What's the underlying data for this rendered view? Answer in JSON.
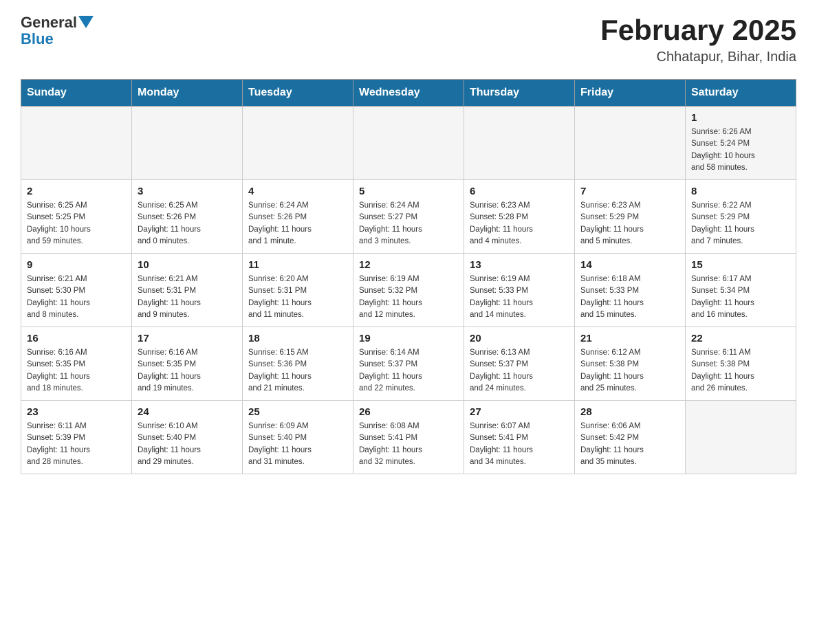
{
  "header": {
    "logo_general": "General",
    "logo_blue": "Blue",
    "month_title": "February 2025",
    "location": "Chhatapur, Bihar, India"
  },
  "weekdays": [
    "Sunday",
    "Monday",
    "Tuesday",
    "Wednesday",
    "Thursday",
    "Friday",
    "Saturday"
  ],
  "weeks": [
    [
      {
        "day": "",
        "info": ""
      },
      {
        "day": "",
        "info": ""
      },
      {
        "day": "",
        "info": ""
      },
      {
        "day": "",
        "info": ""
      },
      {
        "day": "",
        "info": ""
      },
      {
        "day": "",
        "info": ""
      },
      {
        "day": "1",
        "info": "Sunrise: 6:26 AM\nSunset: 5:24 PM\nDaylight: 10 hours\nand 58 minutes."
      }
    ],
    [
      {
        "day": "2",
        "info": "Sunrise: 6:25 AM\nSunset: 5:25 PM\nDaylight: 10 hours\nand 59 minutes."
      },
      {
        "day": "3",
        "info": "Sunrise: 6:25 AM\nSunset: 5:26 PM\nDaylight: 11 hours\nand 0 minutes."
      },
      {
        "day": "4",
        "info": "Sunrise: 6:24 AM\nSunset: 5:26 PM\nDaylight: 11 hours\nand 1 minute."
      },
      {
        "day": "5",
        "info": "Sunrise: 6:24 AM\nSunset: 5:27 PM\nDaylight: 11 hours\nand 3 minutes."
      },
      {
        "day": "6",
        "info": "Sunrise: 6:23 AM\nSunset: 5:28 PM\nDaylight: 11 hours\nand 4 minutes."
      },
      {
        "day": "7",
        "info": "Sunrise: 6:23 AM\nSunset: 5:29 PM\nDaylight: 11 hours\nand 5 minutes."
      },
      {
        "day": "8",
        "info": "Sunrise: 6:22 AM\nSunset: 5:29 PM\nDaylight: 11 hours\nand 7 minutes."
      }
    ],
    [
      {
        "day": "9",
        "info": "Sunrise: 6:21 AM\nSunset: 5:30 PM\nDaylight: 11 hours\nand 8 minutes."
      },
      {
        "day": "10",
        "info": "Sunrise: 6:21 AM\nSunset: 5:31 PM\nDaylight: 11 hours\nand 9 minutes."
      },
      {
        "day": "11",
        "info": "Sunrise: 6:20 AM\nSunset: 5:31 PM\nDaylight: 11 hours\nand 11 minutes."
      },
      {
        "day": "12",
        "info": "Sunrise: 6:19 AM\nSunset: 5:32 PM\nDaylight: 11 hours\nand 12 minutes."
      },
      {
        "day": "13",
        "info": "Sunrise: 6:19 AM\nSunset: 5:33 PM\nDaylight: 11 hours\nand 14 minutes."
      },
      {
        "day": "14",
        "info": "Sunrise: 6:18 AM\nSunset: 5:33 PM\nDaylight: 11 hours\nand 15 minutes."
      },
      {
        "day": "15",
        "info": "Sunrise: 6:17 AM\nSunset: 5:34 PM\nDaylight: 11 hours\nand 16 minutes."
      }
    ],
    [
      {
        "day": "16",
        "info": "Sunrise: 6:16 AM\nSunset: 5:35 PM\nDaylight: 11 hours\nand 18 minutes."
      },
      {
        "day": "17",
        "info": "Sunrise: 6:16 AM\nSunset: 5:35 PM\nDaylight: 11 hours\nand 19 minutes."
      },
      {
        "day": "18",
        "info": "Sunrise: 6:15 AM\nSunset: 5:36 PM\nDaylight: 11 hours\nand 21 minutes."
      },
      {
        "day": "19",
        "info": "Sunrise: 6:14 AM\nSunset: 5:37 PM\nDaylight: 11 hours\nand 22 minutes."
      },
      {
        "day": "20",
        "info": "Sunrise: 6:13 AM\nSunset: 5:37 PM\nDaylight: 11 hours\nand 24 minutes."
      },
      {
        "day": "21",
        "info": "Sunrise: 6:12 AM\nSunset: 5:38 PM\nDaylight: 11 hours\nand 25 minutes."
      },
      {
        "day": "22",
        "info": "Sunrise: 6:11 AM\nSunset: 5:38 PM\nDaylight: 11 hours\nand 26 minutes."
      }
    ],
    [
      {
        "day": "23",
        "info": "Sunrise: 6:11 AM\nSunset: 5:39 PM\nDaylight: 11 hours\nand 28 minutes."
      },
      {
        "day": "24",
        "info": "Sunrise: 6:10 AM\nSunset: 5:40 PM\nDaylight: 11 hours\nand 29 minutes."
      },
      {
        "day": "25",
        "info": "Sunrise: 6:09 AM\nSunset: 5:40 PM\nDaylight: 11 hours\nand 31 minutes."
      },
      {
        "day": "26",
        "info": "Sunrise: 6:08 AM\nSunset: 5:41 PM\nDaylight: 11 hours\nand 32 minutes."
      },
      {
        "day": "27",
        "info": "Sunrise: 6:07 AM\nSunset: 5:41 PM\nDaylight: 11 hours\nand 34 minutes."
      },
      {
        "day": "28",
        "info": "Sunrise: 6:06 AM\nSunset: 5:42 PM\nDaylight: 11 hours\nand 35 minutes."
      },
      {
        "day": "",
        "info": ""
      }
    ]
  ]
}
